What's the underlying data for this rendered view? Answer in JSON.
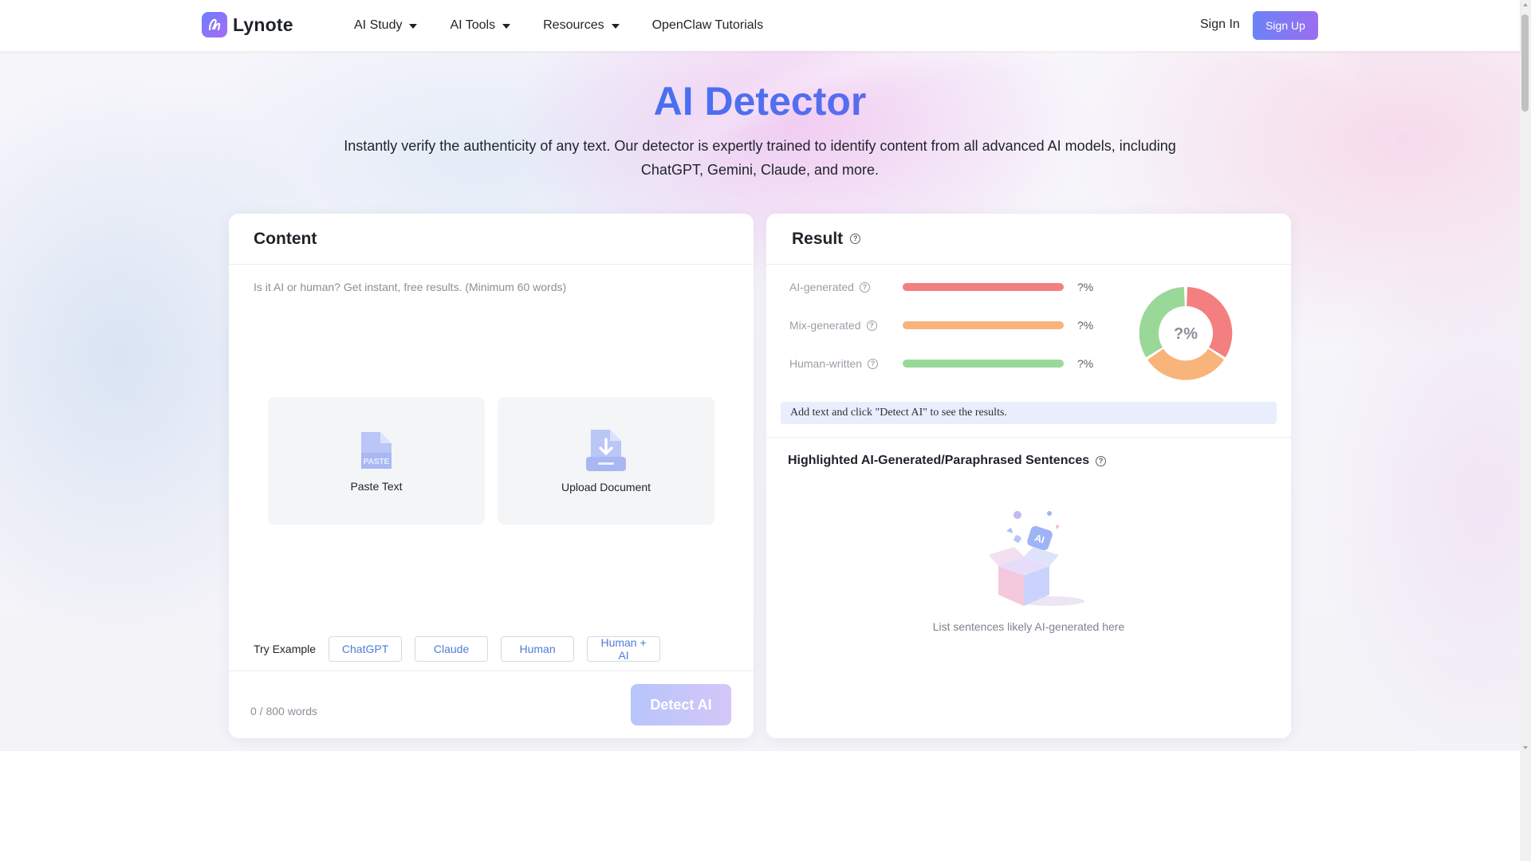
{
  "header": {
    "brand": "Lynote",
    "nav": [
      {
        "label": "AI Study",
        "has_dropdown": true
      },
      {
        "label": "AI Tools",
        "has_dropdown": true
      },
      {
        "label": "Resources",
        "has_dropdown": true
      },
      {
        "label": "OpenClaw Tutorials",
        "has_dropdown": false
      }
    ],
    "sign_in": "Sign In",
    "sign_up": "Sign Up"
  },
  "hero": {
    "title": "AI Detector",
    "subtitle": "Instantly verify the authenticity of any text. Our detector is expertly trained to identify content from all advanced AI models, including ChatGPT, Gemini, Claude, and more."
  },
  "content_card": {
    "title": "Content",
    "placeholder": "Is it AI or human? Get instant, free results. (Minimum 60 words)",
    "paste_label": "Paste Text",
    "paste_icon_text": "PASTE",
    "upload_label": "Upload Document",
    "try_example_label": "Try Example",
    "examples": [
      "ChatGPT",
      "Claude",
      "Human",
      "Human + AI"
    ],
    "word_count": "0 / 800 words",
    "detect_button": "Detect AI"
  },
  "result_card": {
    "title": "Result",
    "rows": [
      {
        "label": "AI-generated",
        "value": "?%",
        "color": "#f47f80"
      },
      {
        "label": "Mix-generated",
        "value": "?%",
        "color": "#f8b47a"
      },
      {
        "label": "Human-written",
        "value": "?%",
        "color": "#9ad89a"
      }
    ],
    "donut_label": "?%",
    "info_text": "Add text and click \"Detect AI\" to see the results.",
    "highlight_title": "Highlighted AI-Generated/Paraphrased Sentences",
    "empty_text": "List sentences likely AI-generated here"
  },
  "colors": {
    "accent_blue": "#4a6ff0",
    "accent_purple": "#9a5de8",
    "chip_text": "#4f7cd6"
  }
}
